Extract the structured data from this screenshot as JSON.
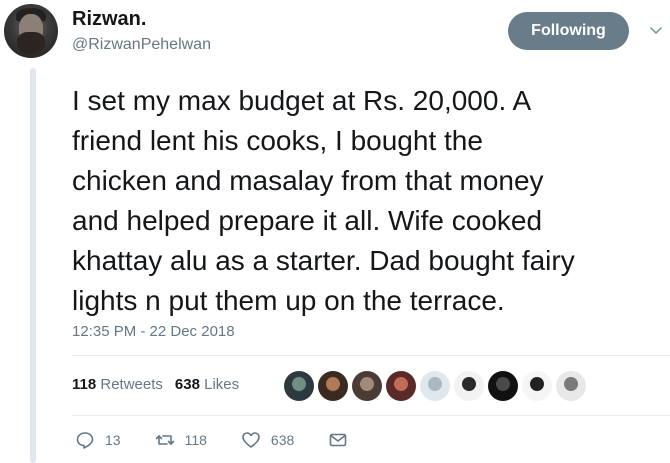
{
  "author": {
    "name": "Rizwan.",
    "handle": "@RizwanPehelwan",
    "follow_label": "Following"
  },
  "tweet": {
    "lines": [
      "I set my max budget at Rs. 20,000. A",
      "friend lent his cooks, I bought the",
      "chicken and masalay from that money",
      "and helped prepare it all. Wife cooked",
      "khattay alu as a starter. Dad bought fairy",
      "lights n put them up on the terrace."
    ],
    "timestamp": "12:35 PM - 22 Dec 2018"
  },
  "stats": {
    "retweets_count": "118",
    "retweets_label": "Retweets",
    "likes_count": "638",
    "likes_label": "Likes"
  },
  "likers": [
    {
      "bg": "#2c3a40",
      "fg": "#6f8f86"
    },
    {
      "bg": "#3a2a22",
      "fg": "#b07a55"
    },
    {
      "bg": "#4a3b34",
      "fg": "#a38b7a"
    },
    {
      "bg": "#5a2a2a",
      "fg": "#c26b55"
    },
    {
      "bg": "#e1e8ed",
      "fg": "#aab8c2"
    },
    {
      "bg": "#f2f2f2",
      "fg": "#2a2a2a"
    },
    {
      "bg": "#111111",
      "fg": "#4a4a4a"
    },
    {
      "bg": "#f5f5f5",
      "fg": "#222222"
    },
    {
      "bg": "#e8e8e8",
      "fg": "#7a7a7a"
    }
  ],
  "actions": {
    "reply_count": "13",
    "retweet_count": "118",
    "like_count": "638"
  },
  "colors": {
    "following_button": "#687c8a",
    "secondary_text": "#657786"
  }
}
